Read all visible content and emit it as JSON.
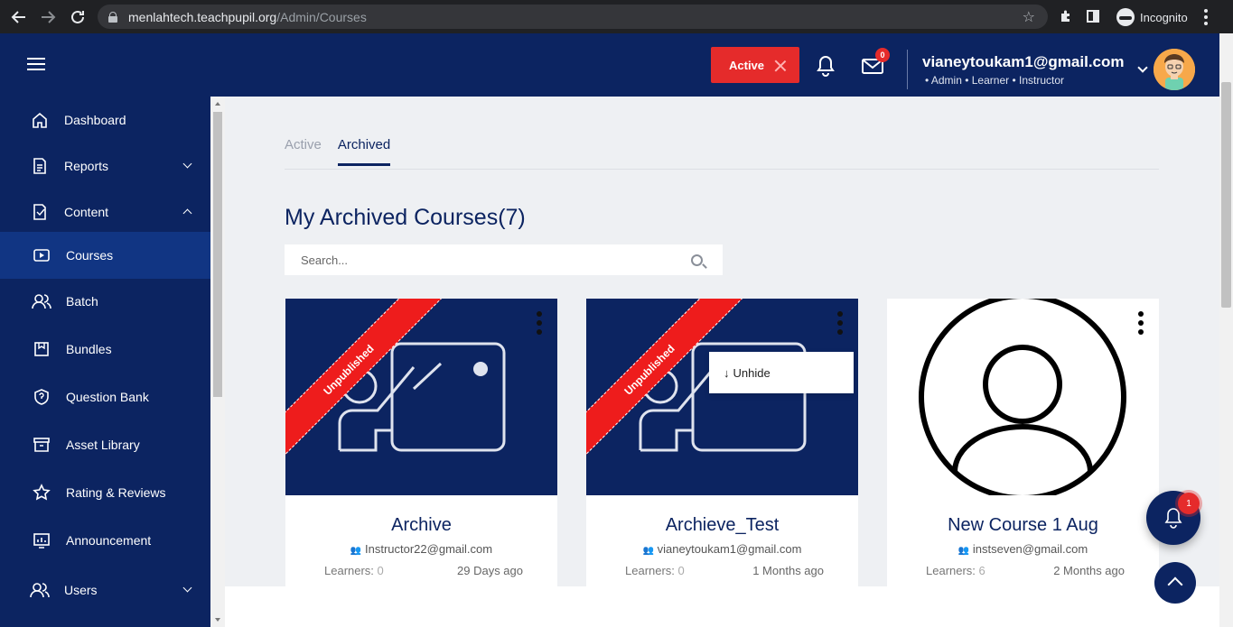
{
  "browser": {
    "url_host": "menlahtech.teachpupil.org",
    "url_path": "/Admin/Courses",
    "profile_label": "Incognito"
  },
  "header": {
    "status_button": "Active",
    "mail_count": "0",
    "user_email": "vianeytoukam1@gmail.com",
    "user_roles": "• Admin • Learner • Instructor"
  },
  "sidebar": {
    "items": [
      {
        "label": "Dashboard",
        "icon": "home-icon"
      },
      {
        "label": "Reports",
        "icon": "report-icon"
      },
      {
        "label": "Content",
        "icon": "content-icon"
      },
      {
        "label": "Courses",
        "icon": "play-icon"
      },
      {
        "label": "Batch",
        "icon": "users-icon"
      },
      {
        "label": "Bundles",
        "icon": "bundle-icon"
      },
      {
        "label": "Question Bank",
        "icon": "shield-icon"
      },
      {
        "label": "Asset Library",
        "icon": "archive-icon"
      },
      {
        "label": "Rating & Reviews",
        "icon": "star-icon"
      },
      {
        "label": "Announcement",
        "icon": "announcement-icon"
      },
      {
        "label": "Users",
        "icon": "users-icon"
      }
    ]
  },
  "main": {
    "tabs": [
      "Active",
      "Archived"
    ],
    "title": "My Archived Courses(7)",
    "search_placeholder": "Search...",
    "unhide_label": "Unhide",
    "courses": [
      {
        "title": "Archive",
        "owner": "Instructor22@gmail.com",
        "learners_label": "Learners:",
        "learners": "0",
        "ago": "29 Days ago",
        "ribbon": "Unpublished"
      },
      {
        "title": "Archieve_Test",
        "owner": "vianeytoukam1@gmail.com",
        "learners_label": "Learners:",
        "learners": "0",
        "ago": "1 Months ago",
        "ribbon": "Unpublished"
      },
      {
        "title": "New Course 1 Aug",
        "owner": "instseven@gmail.com",
        "learners_label": "Learners:",
        "learners": "6",
        "ago": "2 Months ago"
      }
    ],
    "notification_count": "1"
  },
  "colors": {
    "brand_navy": "#0c2461",
    "accent_red": "#e52b2b"
  }
}
